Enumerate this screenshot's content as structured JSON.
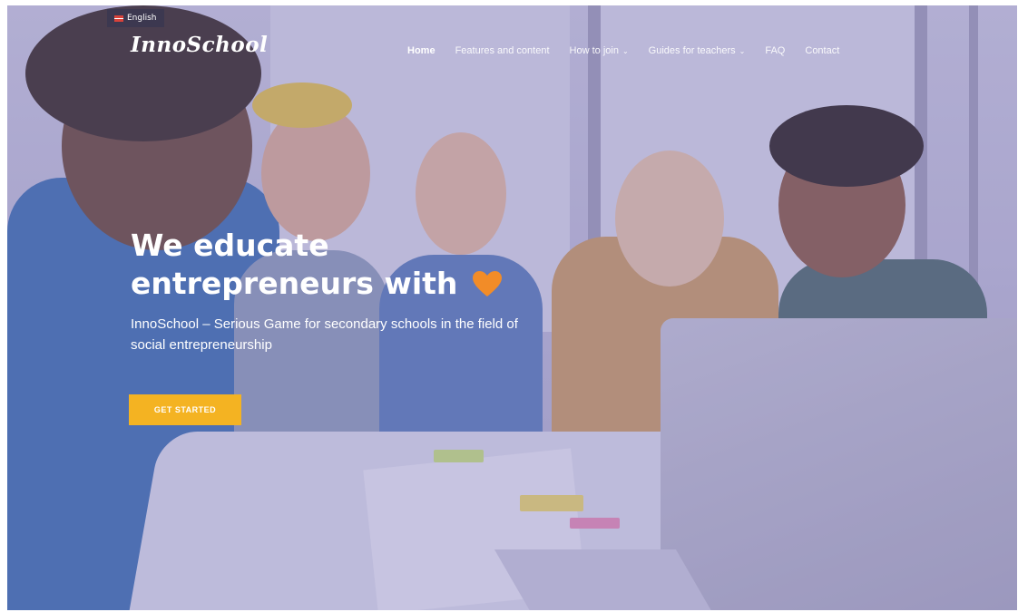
{
  "language": {
    "label": "English",
    "flag_icon": "flag-icon"
  },
  "brand": {
    "logo_text": "InnoSchool"
  },
  "nav": {
    "items": [
      {
        "label": "Home",
        "active": true,
        "has_dropdown": false
      },
      {
        "label": "Features and content",
        "active": false,
        "has_dropdown": false
      },
      {
        "label": "How to join",
        "active": false,
        "has_dropdown": true
      },
      {
        "label": "Guides for teachers",
        "active": false,
        "has_dropdown": true
      },
      {
        "label": "FAQ",
        "active": false,
        "has_dropdown": false
      },
      {
        "label": "Contact",
        "active": false,
        "has_dropdown": false
      }
    ],
    "dropdown_icon": "chevron-down-icon"
  },
  "hero": {
    "title_line1": "We educate",
    "title_line2": "entrepreneurs with",
    "title_icon": "heart-icon",
    "subtitle": "InnoSchool – Serious Game for secondary schools in the field of social entrepreneurship",
    "cta_label": "GET STARTED"
  },
  "colors": {
    "accent": "#f4b322",
    "heart": "#f28c28",
    "overlay": "#786ebe"
  }
}
